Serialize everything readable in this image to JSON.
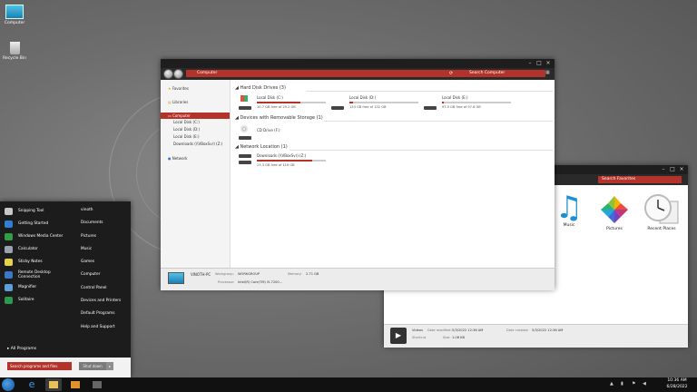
{
  "desktop": {
    "icons": [
      {
        "label": "Computer",
        "icon": "monitor-icon"
      },
      {
        "label": "Recycle Bin",
        "icon": "recycle-bin-icon"
      }
    ]
  },
  "explorer": {
    "address": "Computer",
    "search_placeholder": "Search Computer",
    "nav": {
      "favorites": "Favorites",
      "libraries": "Libraries",
      "computer": "Computer",
      "drives": [
        "Local Disk (C:)",
        "Local Disk (D:)",
        "Local Disk (E:)",
        "Downloads (\\\\VBoxSvr) (Z:)"
      ],
      "network": "Network"
    },
    "sections": {
      "hdd": "Hard Disk Drives (3)",
      "removable": "Devices with Removable Storage (1)",
      "network": "Network Location (1)"
    },
    "drives": [
      {
        "name": "Local Disk (C:)",
        "free": "10.7 GB free of 29.2 GB",
        "used_fraction": 0.63
      },
      {
        "name": "Local Disk (D:)",
        "free": "133 GB free of 102 GB",
        "used_fraction": 0.05
      },
      {
        "name": "Local Disk (E:)",
        "free": "97.0 GB free of 97.6 GB",
        "used_fraction": 0.03
      }
    ],
    "cd": {
      "name": "CD Drive (F:)"
    },
    "netdrive": {
      "name": "Downloads (\\\\VBoxSvr) (Z:)",
      "free": "23.3 GB free of 116 GB",
      "used_fraction": 0.8
    },
    "details": {
      "pc_name": "VINOTH-PC",
      "workgroup_label": "Workgroup:",
      "workgroup": "WORKGROUP",
      "memory_label": "Memory:",
      "memory": "2.71 GB",
      "processor_label": "Processor:",
      "processor": "Intel(R) Core(TM) i5-7200..."
    }
  },
  "favorites_window": {
    "search_placeholder": "Search Favorites",
    "items": [
      {
        "label": "Music",
        "icon": "music-icon"
      },
      {
        "label": "Pictures",
        "icon": "pictures-icon"
      },
      {
        "label": "Recent Places",
        "icon": "recent-places-icon"
      }
    ],
    "details": {
      "name": "Videos",
      "type": "Shortcut",
      "modified_label": "Date modified:",
      "modified": "5/3/2022 12:36 AM",
      "created_label": "Date created:",
      "created": "5/3/2022 12:36 AM",
      "size_label": "Size:",
      "size": "1.06 KB"
    }
  },
  "start_menu": {
    "programs": [
      {
        "label": "Snipping Tool",
        "color": "#c8c8c8"
      },
      {
        "label": "Getting Started",
        "color": "#2f7fd6"
      },
      {
        "label": "Windows Media Center",
        "color": "#2ea043"
      },
      {
        "label": "Calculator",
        "color": "#9aa3ad"
      },
      {
        "label": "Sticky Notes",
        "color": "#e7d34a"
      },
      {
        "label": "Remote Desktop Connection",
        "color": "#3a78c8"
      },
      {
        "label": "Magnifier",
        "color": "#5ba0d8"
      },
      {
        "label": "Solitaire",
        "color": "#2c9a4a"
      }
    ],
    "all_programs": "All Programs",
    "search_placeholder": "Search programs and files",
    "shutdown": "Shut down",
    "right": [
      "vinoth",
      "Documents",
      "Pictures",
      "Music",
      "Games",
      "Computer",
      "Control Panel",
      "Devices and Printers",
      "Default Programs",
      "Help and Support"
    ]
  },
  "taskbar": {
    "time": "10:36 AM",
    "date": "6/28/2022"
  },
  "colors": {
    "accent": "#b3322a",
    "dark": "#1c1c1c"
  }
}
